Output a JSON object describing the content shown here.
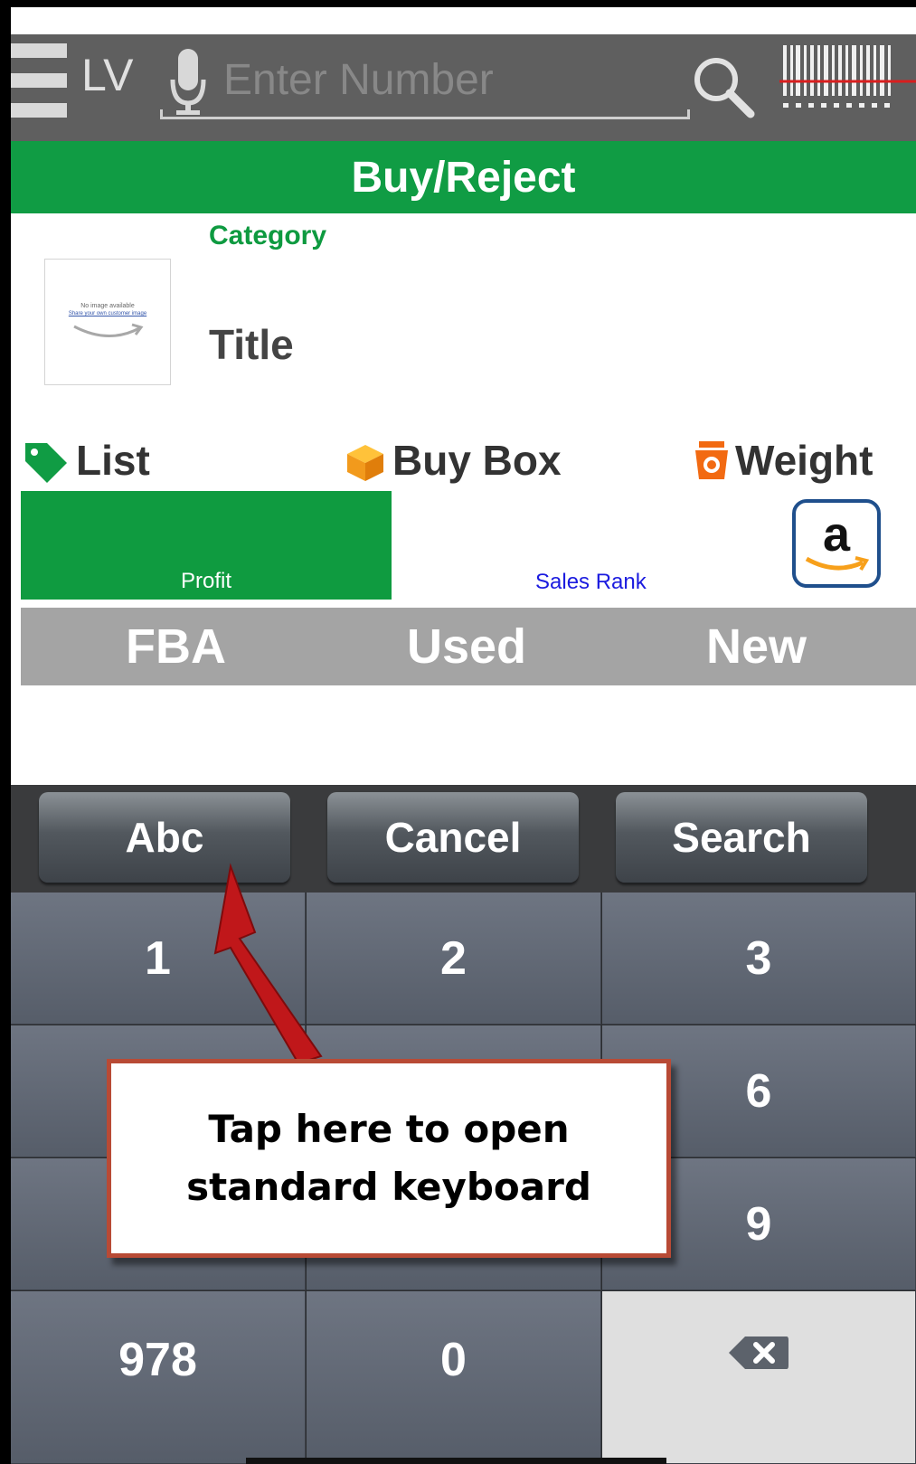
{
  "top_bar": {
    "mode_label": "LV",
    "number_placeholder": "Enter Number",
    "icons": [
      "menu-icon",
      "microphone-icon",
      "search-icon",
      "barcode-scanner-icon"
    ]
  },
  "header": {
    "title": "Buy/Reject"
  },
  "product": {
    "category": "Category",
    "title": "Title",
    "no_image_text": "No image available",
    "customer_image_link": "Share your own customer image"
  },
  "stats": {
    "list_label": "List",
    "buy_box_label": "Buy Box",
    "weight_label": "Weight",
    "profit_label": "Profit",
    "sales_rank_label": "Sales Rank",
    "amazon_letter": "a"
  },
  "tabs": [
    {
      "label": "FBA"
    },
    {
      "label": "Used"
    },
    {
      "label": "New"
    }
  ],
  "keyboard": {
    "actions": [
      "Abc",
      "Cancel",
      "Search"
    ],
    "keys": [
      "1",
      "2",
      "3",
      "",
      "",
      "6",
      "",
      "",
      "9",
      "978",
      "0",
      "backspace"
    ]
  },
  "annotation": {
    "text": "Tap here to open\nstandard keyboard"
  },
  "colors": {
    "brand_green": "#109c44",
    "top_bar": "#5f5f5f",
    "tab_gray": "#a4a4a4",
    "callout_border": "#b84a35",
    "arrow_red": "#c0171a"
  }
}
